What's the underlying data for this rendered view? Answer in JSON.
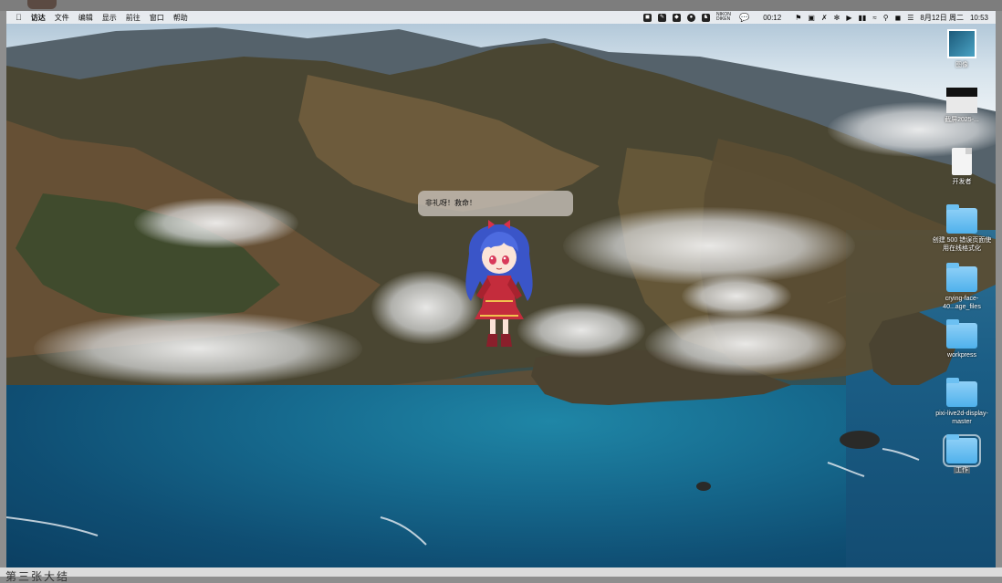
{
  "menubar": {
    "apple_icon": "apple-icon",
    "menus": [
      "访达",
      "文件",
      "编辑",
      "显示",
      "前往",
      "窗口",
      "帮助"
    ],
    "status_icons": [
      "app-icon-1",
      "app-icon-2",
      "app-icon-3",
      "app-icon-4",
      "app-icon-5"
    ],
    "nikon_label": "NIKON DIKEN",
    "wechat_icon": "wechat-icon",
    "timer": "00:12",
    "extra_icons": [
      "bookmark-icon",
      "screen-icon",
      "mute-icon",
      "bluetooth-icon",
      "play-icon",
      "battery-icon",
      "wifi-icon",
      "search-icon",
      "screen-share-icon",
      "control-center-icon"
    ],
    "date": "8月12日 周二",
    "time": "10:53"
  },
  "bubble": {
    "text": "非礼呀！救命！"
  },
  "desktop_icons": [
    {
      "label": "图像",
      "type": "image"
    },
    {
      "label": "截屏2025-...",
      "type": "screenshot"
    },
    {
      "label": "开发者",
      "type": "document"
    },
    {
      "label": "创建 500 错误页面使用在线格式化",
      "type": "folder"
    },
    {
      "label": "crying-face-40...age_files",
      "type": "folder"
    },
    {
      "label": "workpress",
      "type": "folder"
    },
    {
      "label": "pixi-live2d-display-master",
      "type": "folder"
    },
    {
      "label": "工作",
      "type": "folder",
      "selected": true
    }
  ],
  "bottom_text": "第三张大结"
}
